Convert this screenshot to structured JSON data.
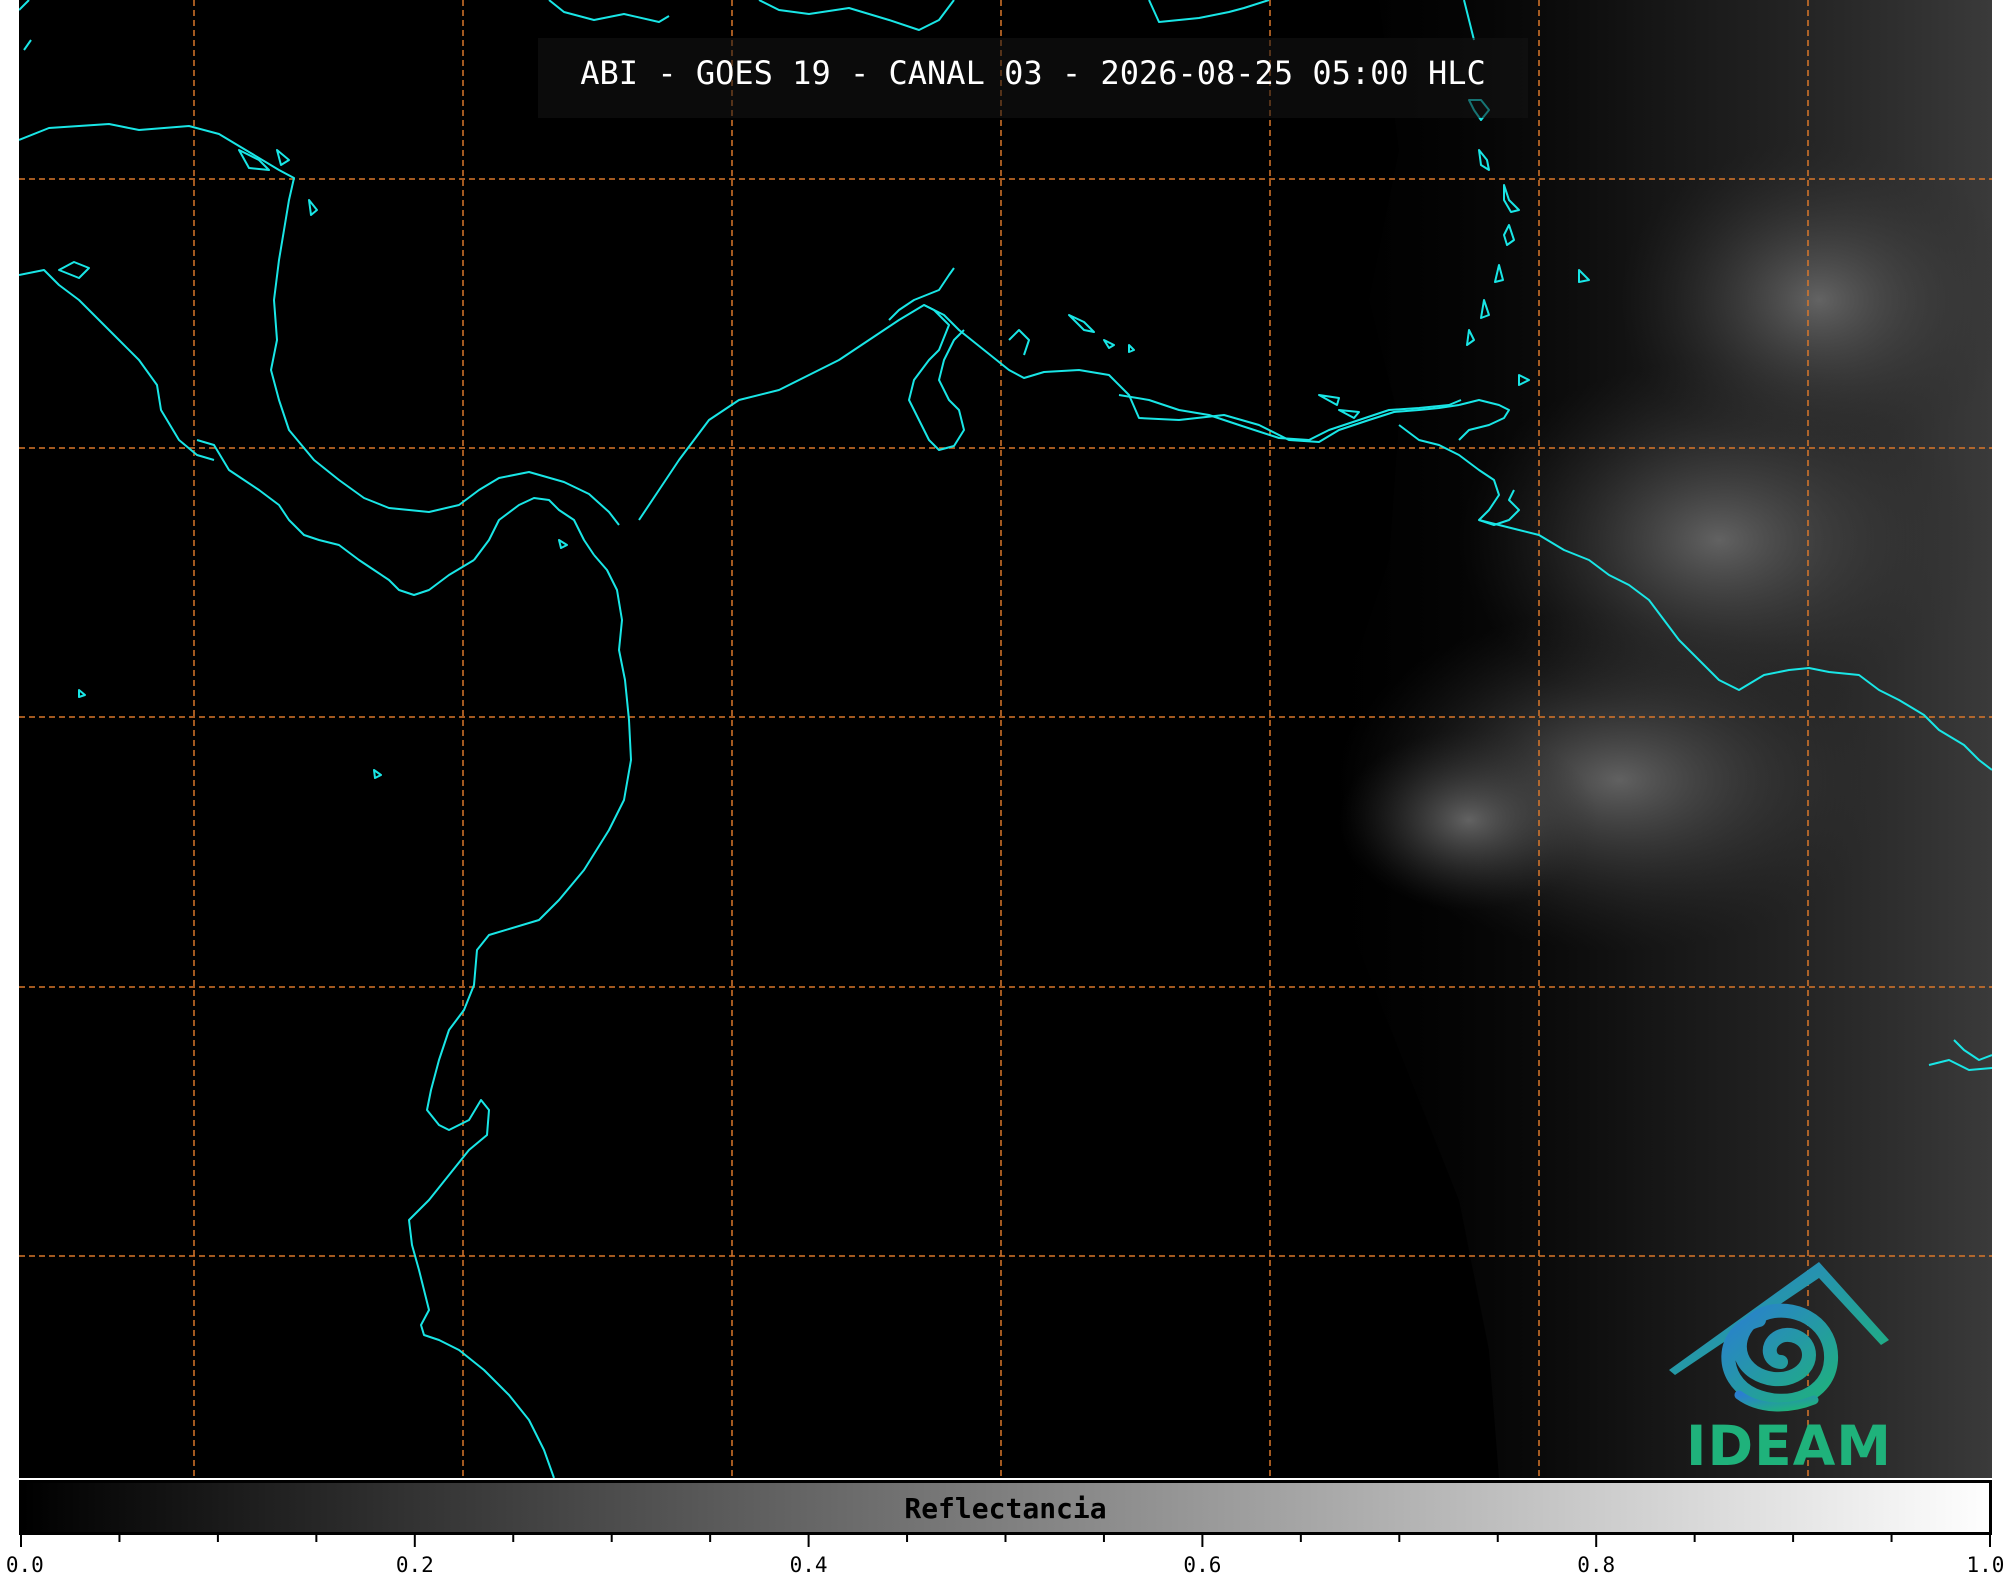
{
  "title": "ABI - GOES 19 - CANAL 03 - 2026-08-25 05:00 HLC",
  "logo_text": "IDEAM",
  "colorbar": {
    "label": "Reflectancia",
    "min": 0.0,
    "max": 1.0,
    "tick_labels": [
      "0.0",
      "0.2",
      "0.4",
      "0.6",
      "0.8",
      "1.0"
    ],
    "colors": [
      "#000000",
      "#ffffff"
    ]
  },
  "colors": {
    "coastline": "#19e6e6",
    "gridline": "#d9772a",
    "logo_blue": "#2a8fc9",
    "logo_green": "#1fb27b"
  }
}
